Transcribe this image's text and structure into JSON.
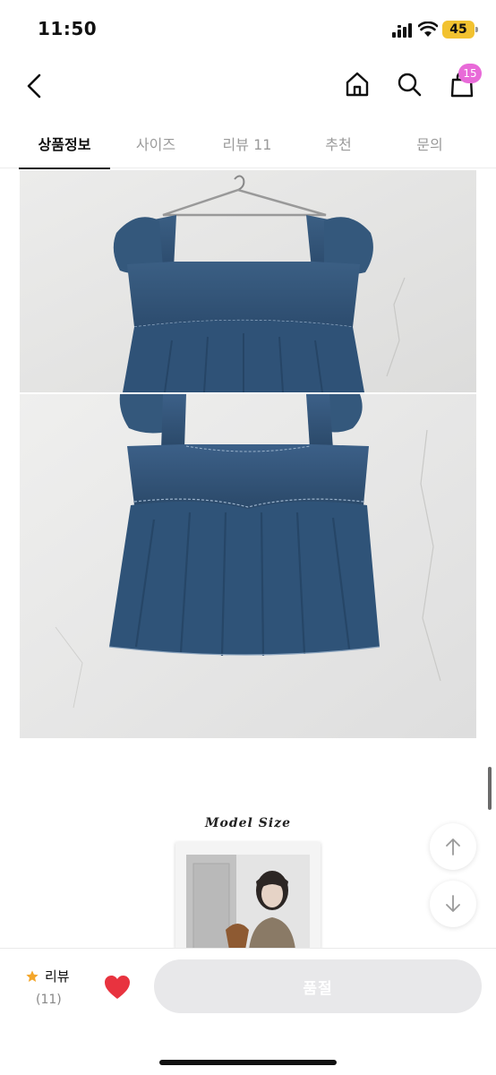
{
  "status_bar": {
    "time": "11:50",
    "battery": "45",
    "battery_color": "#f2c230"
  },
  "nav": {
    "back_icon": "chevron-left-icon",
    "home_icon": "home-icon",
    "search_icon": "search-icon",
    "cart_icon": "shopping-bag-icon",
    "cart_count": "15",
    "badge_color": "#e86ad8"
  },
  "tabs": [
    {
      "label": "상품정보",
      "active": true
    },
    {
      "label": "사이즈",
      "active": false
    },
    {
      "label": "리뷰 11",
      "active": false
    },
    {
      "label": "추천",
      "active": false
    },
    {
      "label": "문의",
      "active": false
    }
  ],
  "content": {
    "model_size_title": "Model Size",
    "scroll_up_icon": "arrow-up-icon",
    "scroll_down_icon": "arrow-down-icon"
  },
  "bottom_bar": {
    "review_label": "리뷰",
    "review_count": "(11)",
    "star_color": "#f4a62a",
    "heart_color": "#e8333f",
    "soldout_label": "품절"
  }
}
